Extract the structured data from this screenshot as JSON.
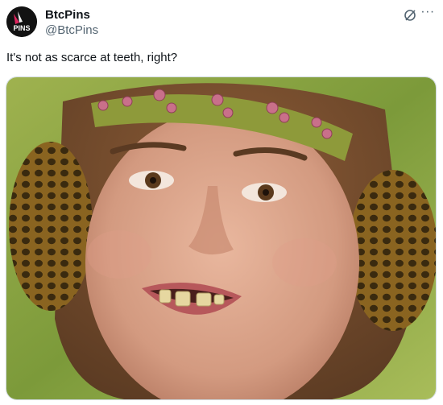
{
  "author": {
    "display_name": "BtcPins",
    "handle": "@BtcPins",
    "avatar_text": "PINS"
  },
  "post": {
    "text": "It's not as scarce at teeth, right?",
    "media": {
      "kind": "photo",
      "subject": "portrait of a woman with a green beaded headband and woven hair buns, smiling with gapped teeth"
    }
  },
  "icons": {
    "grok": "grok-icon",
    "more": "more-options-icon"
  },
  "colors": {
    "text_primary": "#0f1419",
    "text_secondary": "#536471",
    "border": "#cfd9de",
    "avatar_accent": "#e0245e"
  }
}
